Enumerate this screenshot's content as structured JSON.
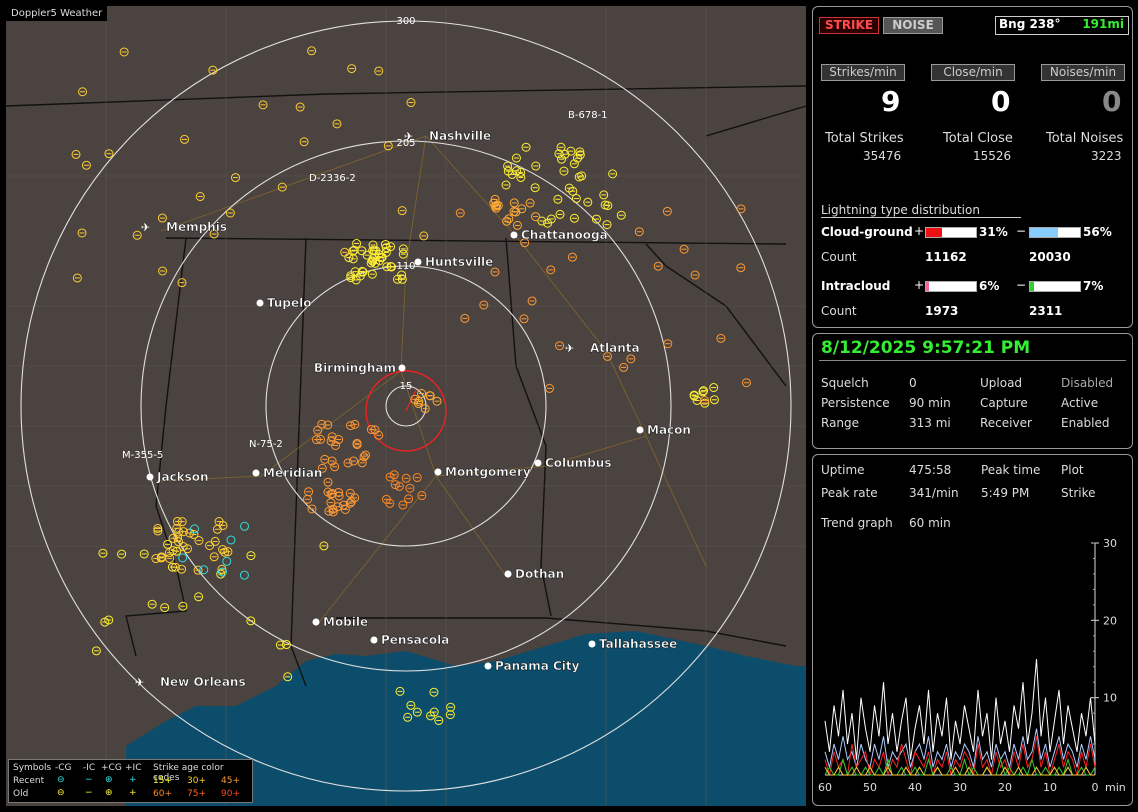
{
  "app": {
    "brand": "Doppler5 Weather"
  },
  "map": {
    "cities": [
      {
        "name": "Nashville",
        "airport": true
      },
      {
        "name": "Memphis",
        "airport": true
      },
      {
        "name": "Chattanooga"
      },
      {
        "name": "Huntsville"
      },
      {
        "name": "Tupelo"
      },
      {
        "name": "Atlanta",
        "airport": true
      },
      {
        "name": "Birmingham"
      },
      {
        "name": "Macon"
      },
      {
        "name": "Jackson"
      },
      {
        "name": "Meridian"
      },
      {
        "name": "Montgomery"
      },
      {
        "name": "Columbus"
      },
      {
        "name": "Dothan"
      },
      {
        "name": "Mobile"
      },
      {
        "name": "Pensacola"
      },
      {
        "name": "Tallahassee"
      },
      {
        "name": "Panama City"
      },
      {
        "name": "New Orleans",
        "airport": true
      }
    ],
    "ring_labels": [
      "300",
      "205",
      "110",
      "15"
    ],
    "storm_tags": [
      "B-678-1",
      "D-2336-2",
      "N-75-2",
      "M-355-5"
    ]
  },
  "legend": {
    "title_symbols": "Symbols",
    "cols": [
      "-CG",
      "-IC",
      "+CG",
      "+IC"
    ],
    "title_age": "Strike age color codes",
    "row_recent": "Recent",
    "row_old": "Old",
    "ages_recent": [
      "15+",
      "30+",
      "45+"
    ],
    "ages_old": [
      "60+",
      "75+",
      "90+"
    ],
    "colors": {
      "c15": "#ffff33",
      "c30": "#ffcc33",
      "c45": "#ff9933",
      "c60": "#ff8822",
      "c75": "#ff6622",
      "c90": "#ff4422",
      "recent": "#33dddd",
      "old": "#ffee33"
    }
  },
  "status": {
    "strike_btn": "STRIKE",
    "noise_btn": "NOISE",
    "bearing": "Bng 238°",
    "distance": "191mi",
    "strikes_per_min_label": "Strikes/min",
    "close_per_min_label": "Close/min",
    "noises_per_min_label": "Noises/min",
    "strikes_per_min": "9",
    "close_per_min": "0",
    "noises_per_min": "0",
    "total_strikes_label": "Total Strikes",
    "total_close_label": "Total Close",
    "total_noises_label": "Total Noises",
    "total_strikes": "35476",
    "total_close": "15526",
    "total_noises": "3223"
  },
  "distribution": {
    "title": "Lightning type distribution",
    "cg_label": "Cloud-ground",
    "ic_label": "Intracloud",
    "count_label": "Count",
    "plus": "+",
    "minus": "−",
    "cg_pos_pct": "31%",
    "cg_neg_pct": "56%",
    "cg_pos_count": "11162",
    "cg_neg_count": "20030",
    "ic_pos_pct": "6%",
    "ic_neg_pct": "7%",
    "ic_pos_count": "1973",
    "ic_neg_count": "2311",
    "cg_pos_frac": 0.31,
    "cg_neg_frac": 0.56,
    "ic_pos_frac": 0.06,
    "ic_neg_frac": 0.07,
    "colors": {
      "cg_pos": "#ee1111",
      "cg_neg": "#88ccff",
      "ic_pos": "#ee6699",
      "ic_neg": "#33cc33"
    }
  },
  "settings": {
    "datetime": "8/12/2025 9:57:21 PM",
    "squelch_label": "Squelch",
    "squelch": "0",
    "upload_label": "Upload",
    "upload": "Disabled",
    "persistence_label": "Persistence",
    "persistence": "90 min",
    "capture_label": "Capture",
    "capture": "Active",
    "range_label": "Range",
    "range": "313 mi",
    "receiver_label": "Receiver",
    "receiver": "Enabled"
  },
  "stats": {
    "uptime_label": "Uptime",
    "uptime": "475:58",
    "peak_time_label": "Peak time",
    "plot_label": "Plot",
    "peak_rate_label": "Peak rate",
    "peak_rate": "341/min",
    "peak_time": "5:49 PM",
    "plot": "Strike",
    "trend_label": "Trend graph",
    "trend": "60 min"
  },
  "chart_data": {
    "type": "line",
    "x": [
      60,
      59,
      58,
      57,
      56,
      55,
      54,
      53,
      52,
      51,
      50,
      49,
      48,
      47,
      46,
      45,
      44,
      43,
      42,
      41,
      40,
      39,
      38,
      37,
      36,
      35,
      34,
      33,
      32,
      31,
      30,
      29,
      28,
      27,
      26,
      25,
      24,
      23,
      22,
      21,
      20,
      19,
      18,
      17,
      16,
      15,
      14,
      13,
      12,
      11,
      10,
      9,
      8,
      7,
      6,
      5,
      4,
      3,
      2,
      1,
      0
    ],
    "xticks": [
      "60",
      "50",
      "40",
      "30",
      "20",
      "10",
      "0"
    ],
    "xunit": "min",
    "yticks": [
      "30",
      "20",
      "10"
    ],
    "ylim": [
      0,
      30
    ],
    "xlim": [
      60,
      0
    ],
    "series": [
      {
        "color": "#ffffff",
        "values": [
          7,
          3,
          9,
          5,
          11,
          4,
          8,
          2,
          10,
          6,
          3,
          9,
          5,
          12,
          4,
          8,
          3,
          7,
          10,
          2,
          6,
          9,
          4,
          11,
          3,
          8,
          5,
          10,
          2,
          7,
          4,
          9,
          6,
          3,
          11,
          5,
          8,
          2,
          10,
          4,
          7,
          3,
          9,
          6,
          12,
          4,
          8,
          15,
          5,
          10,
          3,
          7,
          11,
          4,
          9,
          6,
          3,
          8,
          5,
          10,
          4
        ]
      },
      {
        "color": "#aaccff",
        "values": [
          3,
          1,
          4,
          2,
          5,
          2,
          3,
          1,
          4,
          2,
          1,
          4,
          2,
          5,
          1,
          3,
          2,
          3,
          4,
          1,
          3,
          4,
          2,
          5,
          1,
          3,
          2,
          4,
          1,
          3,
          2,
          4,
          3,
          1,
          5,
          2,
          3,
          1,
          4,
          2,
          3,
          1,
          4,
          2,
          5,
          2,
          3,
          6,
          2,
          4,
          1,
          3,
          5,
          2,
          4,
          3,
          1,
          4,
          2,
          5,
          2
        ]
      },
      {
        "color": "#ff2222",
        "values": [
          2,
          0,
          3,
          1,
          2,
          0,
          4,
          1,
          2,
          3,
          0,
          2,
          1,
          3,
          0,
          2,
          1,
          4,
          2,
          0,
          3,
          2,
          1,
          3,
          0,
          2,
          1,
          3,
          0,
          2,
          1,
          3,
          2,
          0,
          4,
          1,
          2,
          0,
          3,
          1,
          2,
          0,
          3,
          1,
          4,
          1,
          2,
          5,
          1,
          3,
          0,
          2,
          4,
          1,
          3,
          2,
          0,
          3,
          1,
          4,
          1
        ]
      },
      {
        "color": "#33cc33",
        "values": [
          0,
          1,
          0,
          0,
          2,
          0,
          1,
          0,
          0,
          1,
          0,
          0,
          1,
          0,
          2,
          0,
          0,
          1,
          0,
          0,
          1,
          0,
          0,
          2,
          0,
          1,
          0,
          0,
          1,
          0,
          0,
          2,
          0,
          1,
          0,
          0,
          1,
          0,
          0,
          2,
          0,
          1,
          0,
          0,
          1,
          0,
          2,
          0,
          0,
          1,
          0,
          0,
          1,
          0,
          2,
          0,
          0,
          1,
          0,
          0,
          1
        ]
      },
      {
        "color": "#ffcc33",
        "values": [
          1,
          0,
          0,
          1,
          0,
          0,
          0,
          1,
          0,
          0,
          1,
          0,
          0,
          0,
          1,
          0,
          0,
          0,
          1,
          0,
          0,
          1,
          0,
          0,
          0,
          1,
          0,
          0,
          0,
          1,
          0,
          0,
          1,
          0,
          0,
          0,
          1,
          0,
          0,
          0,
          1,
          0,
          0,
          1,
          0,
          0,
          0,
          1,
          0,
          0,
          0,
          1,
          0,
          0,
          1,
          0,
          0,
          0,
          1,
          0,
          0
        ]
      }
    ]
  }
}
